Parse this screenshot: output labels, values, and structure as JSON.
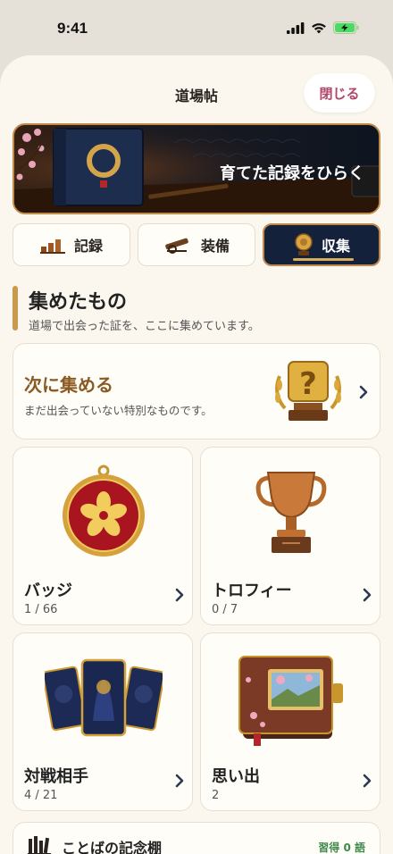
{
  "status": {
    "time": "9:41"
  },
  "sheet": {
    "title": "道場帖",
    "close_label": "閉じる"
  },
  "banner": {
    "text": "育てた記録をひらく"
  },
  "tabs": [
    {
      "label": "記録",
      "icon": "bar-chart-icon",
      "active": false
    },
    {
      "label": "装備",
      "icon": "cannon-icon",
      "active": false
    },
    {
      "label": "収集",
      "icon": "medal-icon",
      "active": true
    }
  ],
  "section": {
    "title": "集めたもの",
    "subtitle": "道場で出会った証を、ここに集めています。"
  },
  "next": {
    "title": "次に集める",
    "subtitle": "まだ出会っていない特別なものです。",
    "icon": "mystery-trophy-icon"
  },
  "cards": [
    {
      "title": "バッジ",
      "count": "1 / 66",
      "icon": "sakura-badge-icon"
    },
    {
      "title": "トロフィー",
      "count": "0 / 7",
      "icon": "trophy-icon"
    },
    {
      "title": "対戦相手",
      "count": "4 / 21",
      "icon": "opponent-cards-icon"
    },
    {
      "title": "思い出",
      "count": "2",
      "icon": "memory-album-icon"
    }
  ],
  "words": {
    "title": "ことばの記念棚",
    "badge": "習得 0 語"
  },
  "colors": {
    "accent": "#c08a4a",
    "active_tab": "#13213b",
    "close_text": "#b1456a",
    "badge_green": "#3f8a4b"
  }
}
